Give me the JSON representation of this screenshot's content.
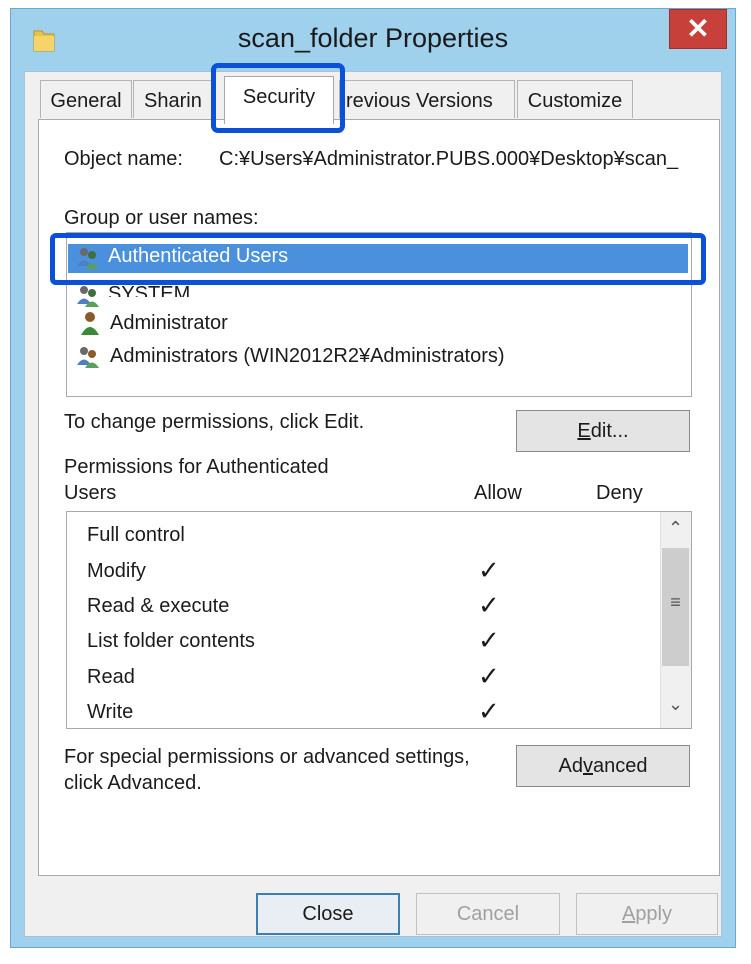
{
  "window": {
    "title": "scan_folder Properties",
    "close_glyph": "✕"
  },
  "tabs": [
    {
      "label": "General"
    },
    {
      "label": "Sharin"
    },
    {
      "label": "Security"
    },
    {
      "label": "revious Versions"
    },
    {
      "label": "Customize"
    }
  ],
  "object": {
    "label": "Object name:",
    "value": "C:¥Users¥Administrator.PUBS.000¥Desktop¥scan_"
  },
  "groups": {
    "label": "Group or user names:",
    "items": [
      {
        "name": "Authenticated Users",
        "icon": "user-group-icon",
        "selected": true
      },
      {
        "name": "SYSTEM",
        "icon": "user-group-icon",
        "selected": false
      },
      {
        "name": "Administrator",
        "icon": "user-icon",
        "selected": false
      },
      {
        "name": "Administrators (WIN2012R2¥Administrators)",
        "icon": "user-group-icon",
        "selected": false
      }
    ]
  },
  "change_text": "To change permissions, click Edit.",
  "edit_button": {
    "prefix": "",
    "underlined": "E",
    "rest": "dit..."
  },
  "permissions": {
    "label_line1": "Permissions for Authenticated",
    "label_line2": "Users",
    "allow_header": "Allow",
    "deny_header": "Deny",
    "rows": [
      {
        "name": "Full control",
        "allow": "",
        "deny": ""
      },
      {
        "name": "Modify",
        "allow": "✓",
        "deny": ""
      },
      {
        "name": "Read & execute",
        "allow": "✓",
        "deny": ""
      },
      {
        "name": "List folder contents",
        "allow": "✓",
        "deny": ""
      },
      {
        "name": "Read",
        "allow": "✓",
        "deny": ""
      },
      {
        "name": "Write",
        "allow": "✓",
        "deny": ""
      }
    ],
    "scroll_up": "⌃",
    "scroll_down": "⌄",
    "scroll_grip": "≡"
  },
  "special_text_line1": "For special permissions or advanced settings,",
  "special_text_line2": "click Advanced.",
  "advanced_button": {
    "prefix": "Ad",
    "underlined": "v",
    "rest": "anced"
  },
  "footer": {
    "close_label": "Close",
    "cancel_label": "Cancel",
    "apply_prefix": "",
    "apply_underlined": "A",
    "apply_rest": "pply"
  },
  "colors": {
    "title_bg": "#9fd0ec",
    "close_bg": "#c7403a",
    "highlight": "#0a50d8",
    "selection": "#4a90dc"
  }
}
